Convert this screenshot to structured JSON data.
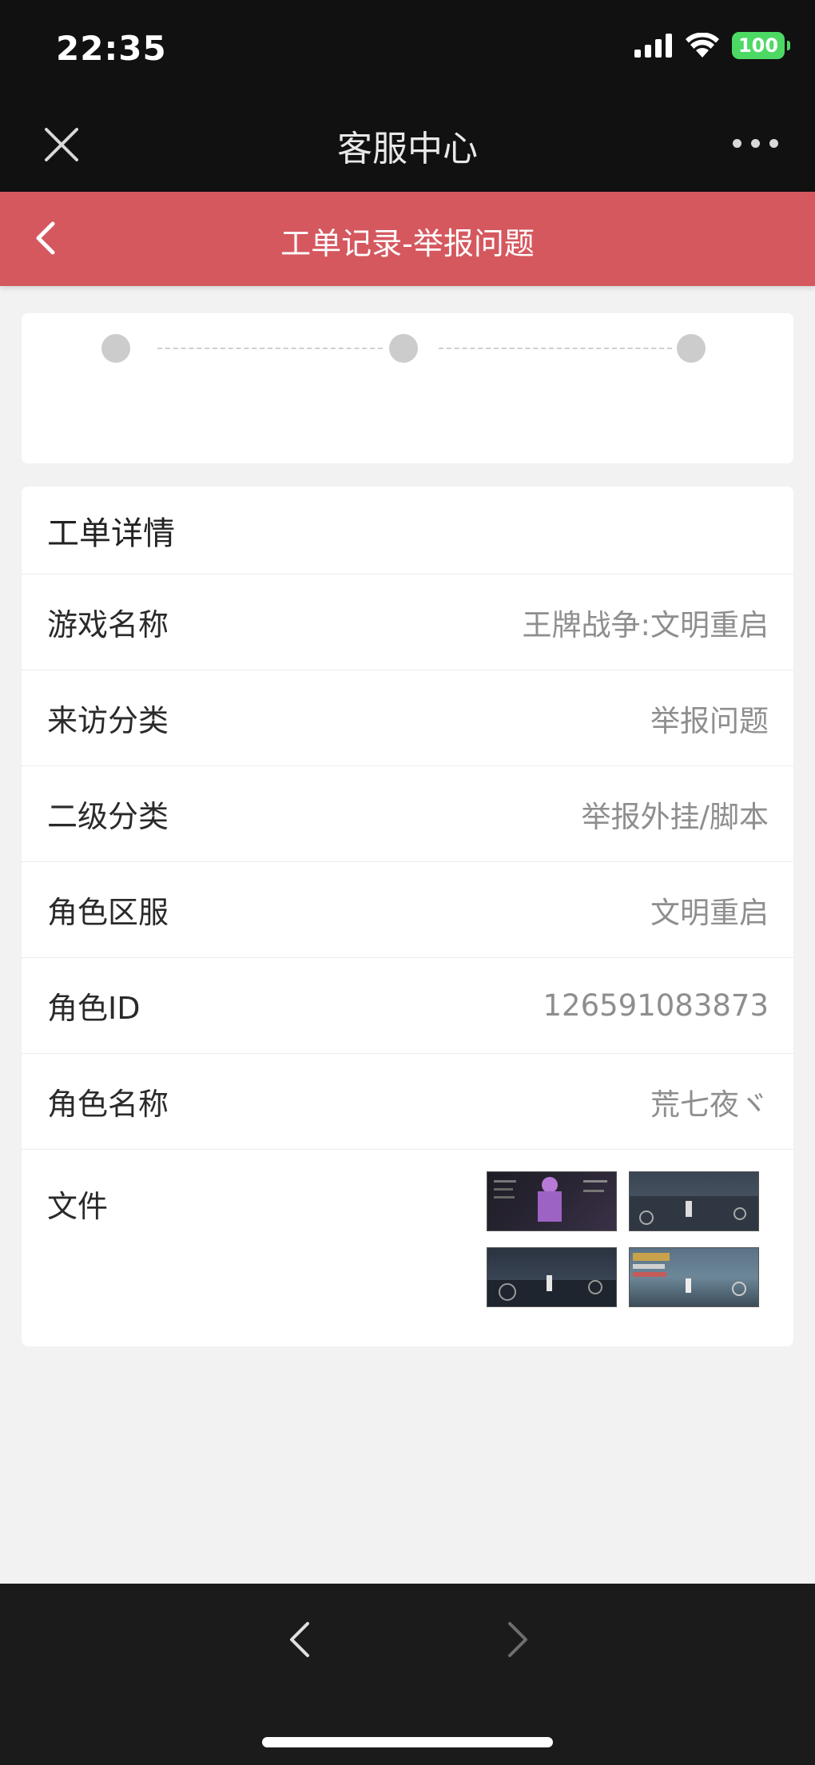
{
  "status_bar": {
    "time": "22:35",
    "battery": "100"
  },
  "app_header": {
    "title": "客服中心"
  },
  "nav_bar": {
    "title": "工单记录-举报问题",
    "color": "#d5585f"
  },
  "progress": {
    "steps": 3
  },
  "detail": {
    "title": "工单详情",
    "rows": [
      {
        "label": "游戏名称",
        "value": "王牌战争:文明重启"
      },
      {
        "label": "来访分类",
        "value": "举报问题"
      },
      {
        "label": "二级分类",
        "value": "举报外挂/脚本"
      },
      {
        "label": "角色区服",
        "value": "文明重启"
      },
      {
        "label": "角色ID",
        "value": "126591083873"
      },
      {
        "label": "角色名称",
        "value": "荒七夜ヾ"
      }
    ],
    "files_label": "文件",
    "files": [
      {
        "icon": "game-screenshot-character-icon"
      },
      {
        "icon": "game-screenshot-rooftop-icon"
      },
      {
        "icon": "game-screenshot-night-icon"
      },
      {
        "icon": "game-screenshot-chat-icon"
      }
    ]
  }
}
